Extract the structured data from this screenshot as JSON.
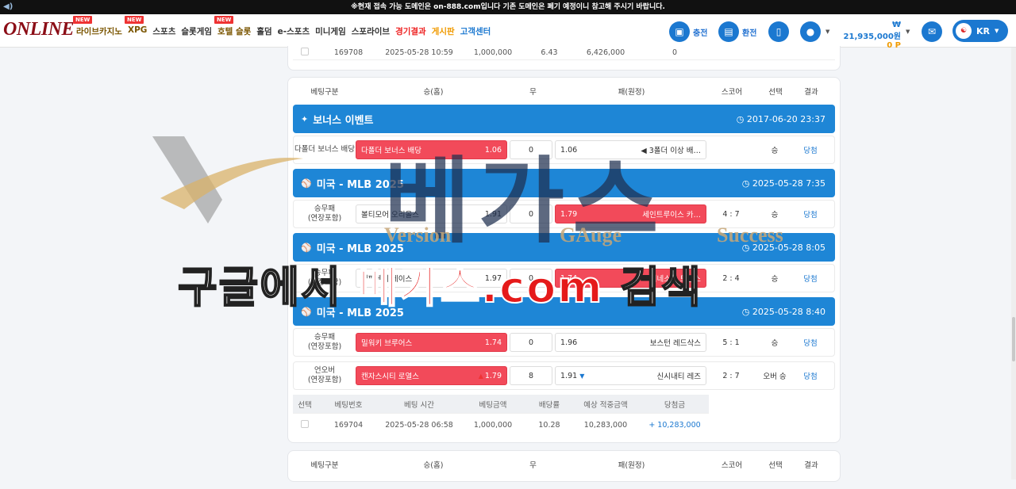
{
  "topbar": {
    "notice": "※현재 접속 가능 도메인은 on-888.com입니다 기존 도메인은 폐기 예정이니 참고해 주시기 바랍니다."
  },
  "header": {
    "logo": "ONLINE",
    "new_badge": "NEW",
    "nav": [
      "라이브카지노",
      "XPG",
      "스포츠",
      "슬롯게임",
      "호텔 슬롯",
      "홀덤",
      "e-스포츠",
      "미니게임",
      "스포라이브",
      "경기결과",
      "게시판",
      "고객센터"
    ],
    "charge": "충전",
    "exchange": "환전",
    "balance": "₩ 21,935,000원",
    "points": "0 P",
    "lang": "KR"
  },
  "summary_top": {
    "id": "169708",
    "time": "2025-05-28 10:59",
    "amount": "1,000,000",
    "odds": "6.43",
    "expected": "6,426,000",
    "win": "0"
  },
  "colheaders": {
    "type": "베팅구분",
    "home": "승(홈)",
    "draw": "무",
    "away": "패(원정)",
    "score": "스코어",
    "choice": "선택",
    "result": "결과"
  },
  "events": [
    {
      "league": "보너스 이벤트",
      "date": "2017-06-20 23:37",
      "bets": [
        {
          "label": "다폴더 보너스 배당",
          "home": "다폴더 보너스 배당",
          "home_odds": "1.06",
          "draw": "0",
          "away_odds": "1.06",
          "away": "◀ 3폴더 이상 배…",
          "score": "",
          "choice": "승",
          "result": "당첨",
          "sel": "home"
        }
      ]
    },
    {
      "league": "미국 - MLB 2025",
      "date": "2025-05-28 7:35",
      "bets": [
        {
          "label": "승무패\n(연장포함)",
          "home": "볼티모어 오리올스",
          "home_odds": "1.91",
          "draw": "0",
          "away_odds": "1.79",
          "away": "세인트루이스 카…",
          "score": "4 : 7",
          "choice": "승",
          "result": "당첨",
          "sel": "away"
        }
      ]
    },
    {
      "league": "미국 - MLB 2025",
      "date": "2025-05-28 8:05",
      "bets": [
        {
          "label": "승무패\n(연장포함)",
          "home": "탬파베이 레이스",
          "home_odds": "1.97",
          "draw": "0",
          "away_odds": "1.74",
          "away": "미네소타 트윈스",
          "score": "2 : 4",
          "choice": "승",
          "result": "당첨",
          "sel": "away"
        }
      ]
    },
    {
      "league": "미국 - MLB 2025",
      "date": "2025-05-28 8:40",
      "bets": [
        {
          "label": "승무패\n(연장포함)",
          "home": "밀워키 브루어스",
          "home_odds": "1.74",
          "draw": "0",
          "away_odds": "1.96",
          "away": "보스턴 레드삭스",
          "score": "5 : 1",
          "choice": "승",
          "result": "당첨",
          "sel": "home"
        },
        {
          "label": "언오버\n(연장포함)",
          "home": "캔자스시티 로열스",
          "home_odds": "1.79",
          "draw": "8",
          "away_odds": "1.91",
          "away": "신시내티 레즈",
          "score": "2 : 7",
          "choice": "오버 승",
          "result": "당첨",
          "sel": "home",
          "home_arrow": "▲",
          "away_arrow": "▼"
        }
      ]
    }
  ],
  "summary": {
    "headers": [
      "선택",
      "베팅번호",
      "베팅 시간",
      "베팅금액",
      "배당률",
      "예상 적중금액",
      "당첨금"
    ],
    "row": {
      "id": "169704",
      "time": "2025-05-28 06:58",
      "amount": "1,000,000",
      "odds": "10.28",
      "expected": "10,283,000",
      "win": "+ 10,283,000"
    }
  },
  "watermark": {
    "big": "베가스",
    "sub1": "Version",
    "sub2": "GAuge",
    "sub3": "Success",
    "line_a": "구글에서 ",
    "line_b": "베가스.com",
    "line_c": " 검색"
  }
}
